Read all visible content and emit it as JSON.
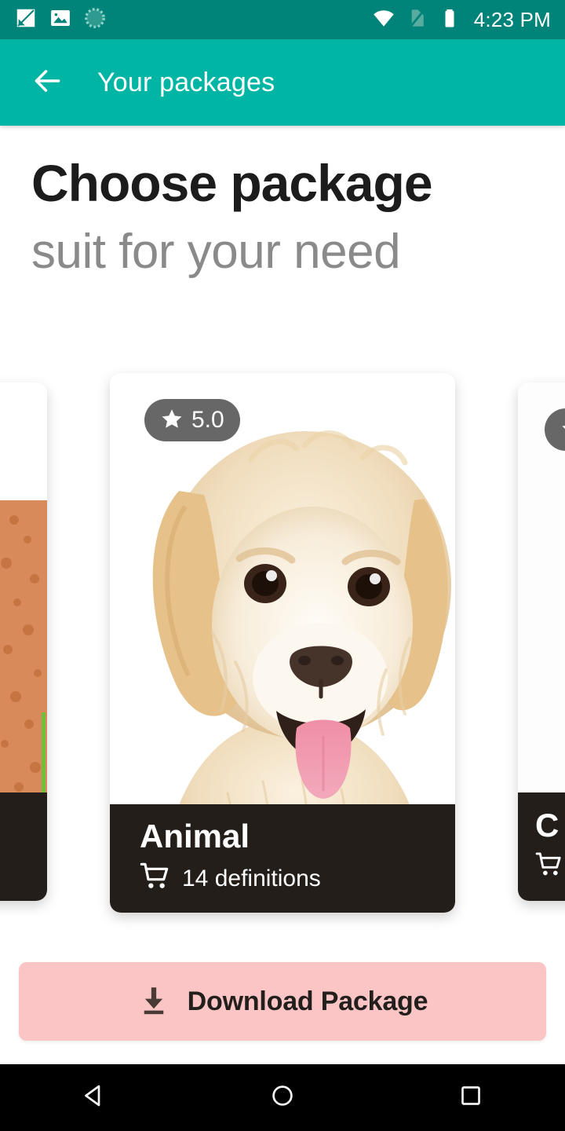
{
  "status_bar": {
    "time": "4:23 PM",
    "left_icons": [
      "screenshot-icon",
      "image-icon",
      "sync-progress-icon"
    ],
    "right_icons": [
      "wifi-icon",
      "no-sim-icon",
      "battery-full-icon"
    ],
    "background_color": "#00847a"
  },
  "app_bar": {
    "back_icon": "arrow-left-icon",
    "title": "Your packages",
    "background_color": "#00b5a3",
    "text_color": "#ffffff"
  },
  "headings": {
    "title": "Choose package",
    "subtitle": "suit for your need",
    "title_color": "#1c1c1c",
    "subtitle_color": "#8a8a8a"
  },
  "carousel": {
    "cards": [
      {
        "position": "left-partial",
        "title": "",
        "rating": "",
        "count_label": "",
        "image": "food-texture-image",
        "footer_color": "#241e1b"
      },
      {
        "position": "center-active",
        "title": "Animal",
        "rating": "5.0",
        "rating_icon": "star-icon",
        "count_icon": "shopping-cart-icon",
        "count_label": "14 definitions",
        "image": "dog-photo",
        "footer_color": "#241e1b",
        "badge_color": "#464646"
      },
      {
        "position": "right-partial",
        "title": "C",
        "rating": "",
        "count_icon": "shopping-cart-icon",
        "count_label": "",
        "image": "white-image",
        "footer_color": "#241e1b"
      }
    ]
  },
  "download_button": {
    "label": "Download Package",
    "icon": "download-icon",
    "background_color": "#fbc5c5",
    "text_color": "#231f1d"
  },
  "nav_bar": {
    "back": "nav-back-triangle-icon",
    "home": "nav-home-circle-icon",
    "recents": "nav-recents-square-icon",
    "background_color": "#000000"
  }
}
